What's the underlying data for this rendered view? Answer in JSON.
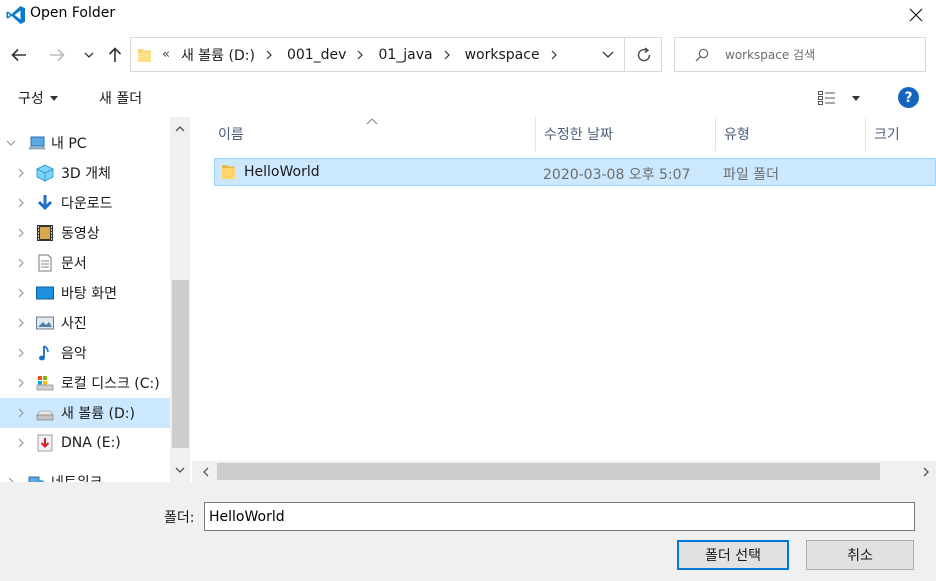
{
  "window": {
    "title": "Open Folder",
    "icon": "vscode-logo-icon",
    "close_icon": "close-icon"
  },
  "address": {
    "overflow_marker": "«",
    "breadcrumbs": [
      "새 볼륨 (D:)",
      "001_dev",
      "01_java",
      "workspace"
    ],
    "search_placeholder": "workspace 검색"
  },
  "toolbar": {
    "organize_label": "구성",
    "new_folder_label": "새 폴더",
    "help_label": "?"
  },
  "nav": {
    "items": [
      {
        "label": "내 PC",
        "icon": "pc-icon"
      },
      {
        "label": "3D 개체",
        "icon": "3d-objects-icon"
      },
      {
        "label": "다운로드",
        "icon": "download-icon"
      },
      {
        "label": "동영상",
        "icon": "video-icon"
      },
      {
        "label": "문서",
        "icon": "document-icon"
      },
      {
        "label": "바탕 화면",
        "icon": "desktop-icon"
      },
      {
        "label": "사진",
        "icon": "pictures-icon"
      },
      {
        "label": "음악",
        "icon": "music-icon"
      },
      {
        "label": "로컬 디스크 (C:)",
        "icon": "local-disk-icon"
      },
      {
        "label": "새 볼륨 (D:)",
        "icon": "drive-icon",
        "selected": true
      },
      {
        "label": "DNA (E:)",
        "icon": "removable-drive-icon"
      },
      {
        "label": "네트워크",
        "icon": "network-icon"
      }
    ]
  },
  "file_list": {
    "columns": [
      "이름",
      "수정한 날짜",
      "유형",
      "크기"
    ],
    "rows": [
      {
        "name": "HelloWorld",
        "modified": "2020-03-08 오후 5:07",
        "type": "파일 폴더",
        "size": ""
      }
    ]
  },
  "footer": {
    "folder_label": "폴더:",
    "folder_value": "HelloWorld",
    "select_button": "폴더 선택",
    "cancel_button": "취소"
  },
  "colors": {
    "selection": "#cce8ff",
    "accent": "#0078d7",
    "help": "#1565c0"
  }
}
